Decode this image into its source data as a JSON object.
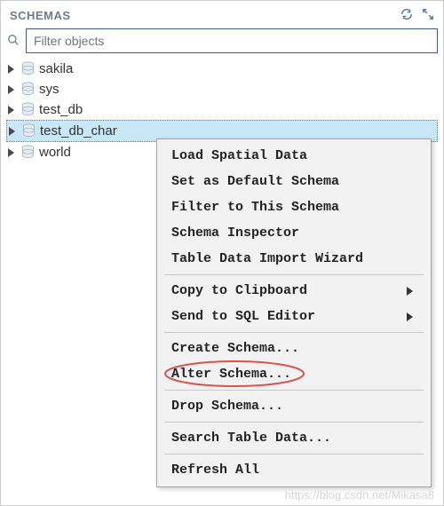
{
  "panel": {
    "title": "SCHEMAS"
  },
  "search": {
    "placeholder": "Filter objects",
    "value": ""
  },
  "schemas": [
    {
      "name": "sakila",
      "selected": false
    },
    {
      "name": "sys",
      "selected": false
    },
    {
      "name": "test_db",
      "selected": false
    },
    {
      "name": "test_db_char",
      "selected": true
    },
    {
      "name": "world",
      "selected": false
    }
  ],
  "context_menu": {
    "groups": [
      [
        {
          "label": "Load Spatial Data",
          "submenu": false
        },
        {
          "label": "Set as Default Schema",
          "submenu": false
        },
        {
          "label": "Filter to This Schema",
          "submenu": false
        },
        {
          "label": "Schema Inspector",
          "submenu": false
        },
        {
          "label": "Table Data Import Wizard",
          "submenu": false
        }
      ],
      [
        {
          "label": "Copy to Clipboard",
          "submenu": true
        },
        {
          "label": "Send to SQL Editor",
          "submenu": true
        }
      ],
      [
        {
          "label": "Create Schema...",
          "submenu": false
        },
        {
          "label": "Alter Schema...",
          "submenu": false,
          "highlighted": true
        }
      ],
      [
        {
          "label": "Drop Schema...",
          "submenu": false
        }
      ],
      [
        {
          "label": "Search Table Data...",
          "submenu": false
        }
      ],
      [
        {
          "label": "Refresh All",
          "submenu": false
        }
      ]
    ]
  },
  "watermark": "https://blog.csdn.net/Mikasa8"
}
